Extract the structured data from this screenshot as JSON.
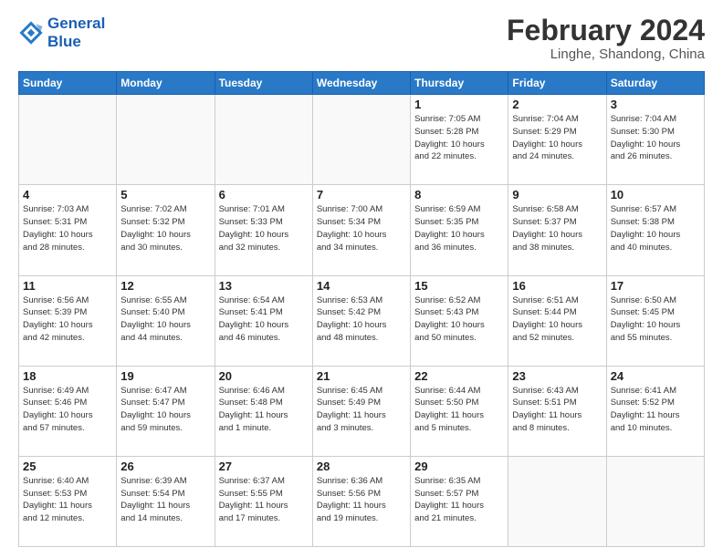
{
  "logo": {
    "line1": "General",
    "line2": "Blue"
  },
  "title": "February 2024",
  "subtitle": "Linghe, Shandong, China",
  "days_of_week": [
    "Sunday",
    "Monday",
    "Tuesday",
    "Wednesday",
    "Thursday",
    "Friday",
    "Saturday"
  ],
  "weeks": [
    [
      {
        "day": "",
        "info": ""
      },
      {
        "day": "",
        "info": ""
      },
      {
        "day": "",
        "info": ""
      },
      {
        "day": "",
        "info": ""
      },
      {
        "day": "1",
        "info": "Sunrise: 7:05 AM\nSunset: 5:28 PM\nDaylight: 10 hours\nand 22 minutes."
      },
      {
        "day": "2",
        "info": "Sunrise: 7:04 AM\nSunset: 5:29 PM\nDaylight: 10 hours\nand 24 minutes."
      },
      {
        "day": "3",
        "info": "Sunrise: 7:04 AM\nSunset: 5:30 PM\nDaylight: 10 hours\nand 26 minutes."
      }
    ],
    [
      {
        "day": "4",
        "info": "Sunrise: 7:03 AM\nSunset: 5:31 PM\nDaylight: 10 hours\nand 28 minutes."
      },
      {
        "day": "5",
        "info": "Sunrise: 7:02 AM\nSunset: 5:32 PM\nDaylight: 10 hours\nand 30 minutes."
      },
      {
        "day": "6",
        "info": "Sunrise: 7:01 AM\nSunset: 5:33 PM\nDaylight: 10 hours\nand 32 minutes."
      },
      {
        "day": "7",
        "info": "Sunrise: 7:00 AM\nSunset: 5:34 PM\nDaylight: 10 hours\nand 34 minutes."
      },
      {
        "day": "8",
        "info": "Sunrise: 6:59 AM\nSunset: 5:35 PM\nDaylight: 10 hours\nand 36 minutes."
      },
      {
        "day": "9",
        "info": "Sunrise: 6:58 AM\nSunset: 5:37 PM\nDaylight: 10 hours\nand 38 minutes."
      },
      {
        "day": "10",
        "info": "Sunrise: 6:57 AM\nSunset: 5:38 PM\nDaylight: 10 hours\nand 40 minutes."
      }
    ],
    [
      {
        "day": "11",
        "info": "Sunrise: 6:56 AM\nSunset: 5:39 PM\nDaylight: 10 hours\nand 42 minutes."
      },
      {
        "day": "12",
        "info": "Sunrise: 6:55 AM\nSunset: 5:40 PM\nDaylight: 10 hours\nand 44 minutes."
      },
      {
        "day": "13",
        "info": "Sunrise: 6:54 AM\nSunset: 5:41 PM\nDaylight: 10 hours\nand 46 minutes."
      },
      {
        "day": "14",
        "info": "Sunrise: 6:53 AM\nSunset: 5:42 PM\nDaylight: 10 hours\nand 48 minutes."
      },
      {
        "day": "15",
        "info": "Sunrise: 6:52 AM\nSunset: 5:43 PM\nDaylight: 10 hours\nand 50 minutes."
      },
      {
        "day": "16",
        "info": "Sunrise: 6:51 AM\nSunset: 5:44 PM\nDaylight: 10 hours\nand 52 minutes."
      },
      {
        "day": "17",
        "info": "Sunrise: 6:50 AM\nSunset: 5:45 PM\nDaylight: 10 hours\nand 55 minutes."
      }
    ],
    [
      {
        "day": "18",
        "info": "Sunrise: 6:49 AM\nSunset: 5:46 PM\nDaylight: 10 hours\nand 57 minutes."
      },
      {
        "day": "19",
        "info": "Sunrise: 6:47 AM\nSunset: 5:47 PM\nDaylight: 10 hours\nand 59 minutes."
      },
      {
        "day": "20",
        "info": "Sunrise: 6:46 AM\nSunset: 5:48 PM\nDaylight: 11 hours\nand 1 minute."
      },
      {
        "day": "21",
        "info": "Sunrise: 6:45 AM\nSunset: 5:49 PM\nDaylight: 11 hours\nand 3 minutes."
      },
      {
        "day": "22",
        "info": "Sunrise: 6:44 AM\nSunset: 5:50 PM\nDaylight: 11 hours\nand 5 minutes."
      },
      {
        "day": "23",
        "info": "Sunrise: 6:43 AM\nSunset: 5:51 PM\nDaylight: 11 hours\nand 8 minutes."
      },
      {
        "day": "24",
        "info": "Sunrise: 6:41 AM\nSunset: 5:52 PM\nDaylight: 11 hours\nand 10 minutes."
      }
    ],
    [
      {
        "day": "25",
        "info": "Sunrise: 6:40 AM\nSunset: 5:53 PM\nDaylight: 11 hours\nand 12 minutes."
      },
      {
        "day": "26",
        "info": "Sunrise: 6:39 AM\nSunset: 5:54 PM\nDaylight: 11 hours\nand 14 minutes."
      },
      {
        "day": "27",
        "info": "Sunrise: 6:37 AM\nSunset: 5:55 PM\nDaylight: 11 hours\nand 17 minutes."
      },
      {
        "day": "28",
        "info": "Sunrise: 6:36 AM\nSunset: 5:56 PM\nDaylight: 11 hours\nand 19 minutes."
      },
      {
        "day": "29",
        "info": "Sunrise: 6:35 AM\nSunset: 5:57 PM\nDaylight: 11 hours\nand 21 minutes."
      },
      {
        "day": "",
        "info": ""
      },
      {
        "day": "",
        "info": ""
      }
    ]
  ]
}
